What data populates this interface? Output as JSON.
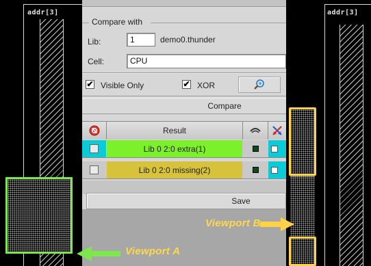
{
  "layout_left": {
    "pin_label": "addr[3]"
  },
  "layout_right": {
    "pin_label": "addr[3]"
  },
  "compare_with": {
    "title": "Compare with",
    "lib_label": "Lib:",
    "lib_value": "1",
    "lib_name": "demo0.thunder",
    "cell_label": "Cell:",
    "cell_value": "CPU"
  },
  "options": {
    "visible_only_label": "Visible Only",
    "visible_only_checked": "✔",
    "xor_label": "XOR",
    "xor_checked": "✔"
  },
  "compare_button": "Compare",
  "results": {
    "header": "Result",
    "rows": [
      {
        "text": "Lib 0 2:0 extra(1)",
        "color": "#7cf02a"
      },
      {
        "text": "Lib 0 2:0 missing(2)",
        "color": "#d6c33b"
      }
    ]
  },
  "save_button": "Save",
  "annotations": {
    "viewport_a": "Viewport A",
    "viewport_b": "Viewport B"
  },
  "colors": {
    "viewport_a": "#7de84c",
    "viewport_b": "#ffd24a",
    "selection": "#0dcbd6"
  },
  "icons": {
    "delete": "delete-icon",
    "visibility": "eye-icon",
    "xor": "cross-arrows-icon",
    "zoom": "magnifier-icon"
  }
}
